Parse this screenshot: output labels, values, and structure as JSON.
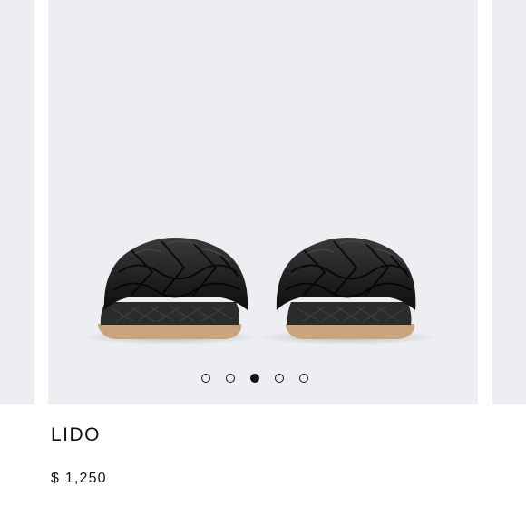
{
  "carousel": {
    "slide_count": 5,
    "active_index": 2,
    "image_icon": "black-woven-slide-sandals-image"
  },
  "product": {
    "name": "LIDO",
    "price": "$ 1,250"
  },
  "colors": {
    "slide_background": "#eceef1",
    "text": "#111111"
  }
}
